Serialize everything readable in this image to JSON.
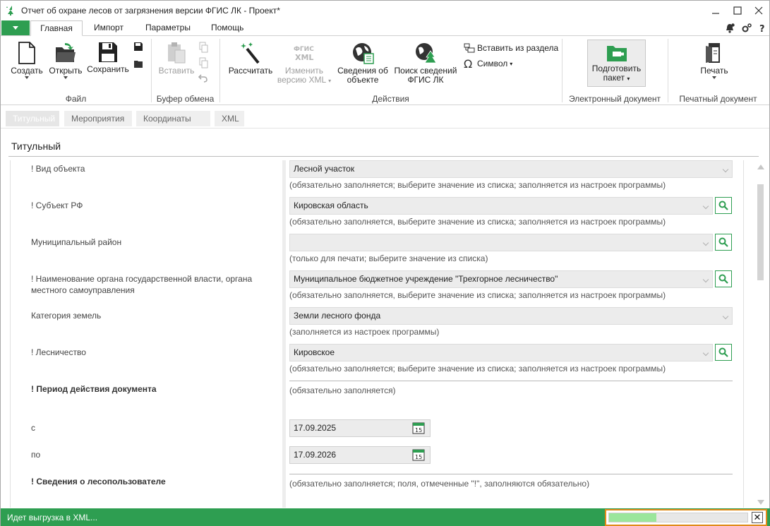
{
  "window": {
    "title": "Отчет об охране лесов от загрязнения версии ФГИС ЛК - Проект*"
  },
  "ribbon_tabs": [
    "Главная",
    "Импорт",
    "Параметры",
    "Помощь"
  ],
  "ribbon": {
    "file": {
      "create": "Создать",
      "open": "Открыть",
      "save": "Сохранить",
      "group": "Файл"
    },
    "clipboard": {
      "paste": "Вставить",
      "group": "Буфер обмена"
    },
    "actions": {
      "calculate": "Рассчитать",
      "change_xml_1": "Изменить",
      "change_xml_2": "версию XML",
      "object_info_1": "Сведения об",
      "object_info_2": "объекте",
      "search_fgis_1": "Поиск сведений",
      "search_fgis_2": "ФГИС ЛК",
      "insert_from_section": "Вставить из раздела",
      "symbol": "Символ",
      "xml_icon_top": "ФГИС",
      "xml_icon_bottom": "XML",
      "group": "Действия"
    },
    "e_doc": {
      "prepare_1": "Подготовить",
      "prepare_2": "пакет",
      "group": "Электронный документ"
    },
    "print_doc": {
      "print": "Печать",
      "group": "Печатный документ"
    }
  },
  "section_tabs": [
    "Титульный",
    "Мероприятия",
    "Координаты",
    "XML"
  ],
  "page_heading": "Титульный",
  "fields": {
    "object_type": {
      "label": "! Вид объекта",
      "value": "Лесной участок",
      "hint": "(обязательно заполняется; выберите значение из списка; заполняется из настроек программы)"
    },
    "subject": {
      "label": "! Субъект РФ",
      "value": "Кировская область",
      "hint": "(обязательно заполняется, выберите значение из списка; заполняется из настроек программы)"
    },
    "district": {
      "label": "Муниципальный район",
      "value": "",
      "hint": "(только для печати; выберите значение из списка)"
    },
    "authority": {
      "label": "! Наименование органа государственной власти, органа местного самоуправления",
      "value": "Муниципальное бюджетное учреждение \"Трехгорное лесничество\"",
      "hint": "(обязательно заполняется, выберите значение из списка; заполняется из настроек программы)"
    },
    "land_category": {
      "label": "Категория земель",
      "value": "Земли лесного фонда",
      "hint": "(заполняется из настроек программы)"
    },
    "forestry": {
      "label": "! Лесничество",
      "value": "Кировское",
      "hint": "(обязательно заполняется; выберите значение из списка; заполняется из настроек программы)"
    },
    "period": {
      "label": "! Период действия документа",
      "hint": "(обязательно заполняется)",
      "from_label": "с",
      "from_value": "17.09.2025",
      "to_label": "по",
      "to_value": "17.09.2026",
      "calendar_day": "15"
    },
    "user_info": {
      "label": "! Сведения о лесопользователе",
      "hint": "(обязательно заполняется; поля, отмеченные \"!\", заполняются обязательно)"
    }
  },
  "status": {
    "text": "Идет выгрузка в XML...",
    "progress_fraction": 0.34,
    "close_label": "✕"
  },
  "colors": {
    "accent": "#2e9e51",
    "progress": "#9be69b",
    "progress_border": "#e08b1a"
  }
}
